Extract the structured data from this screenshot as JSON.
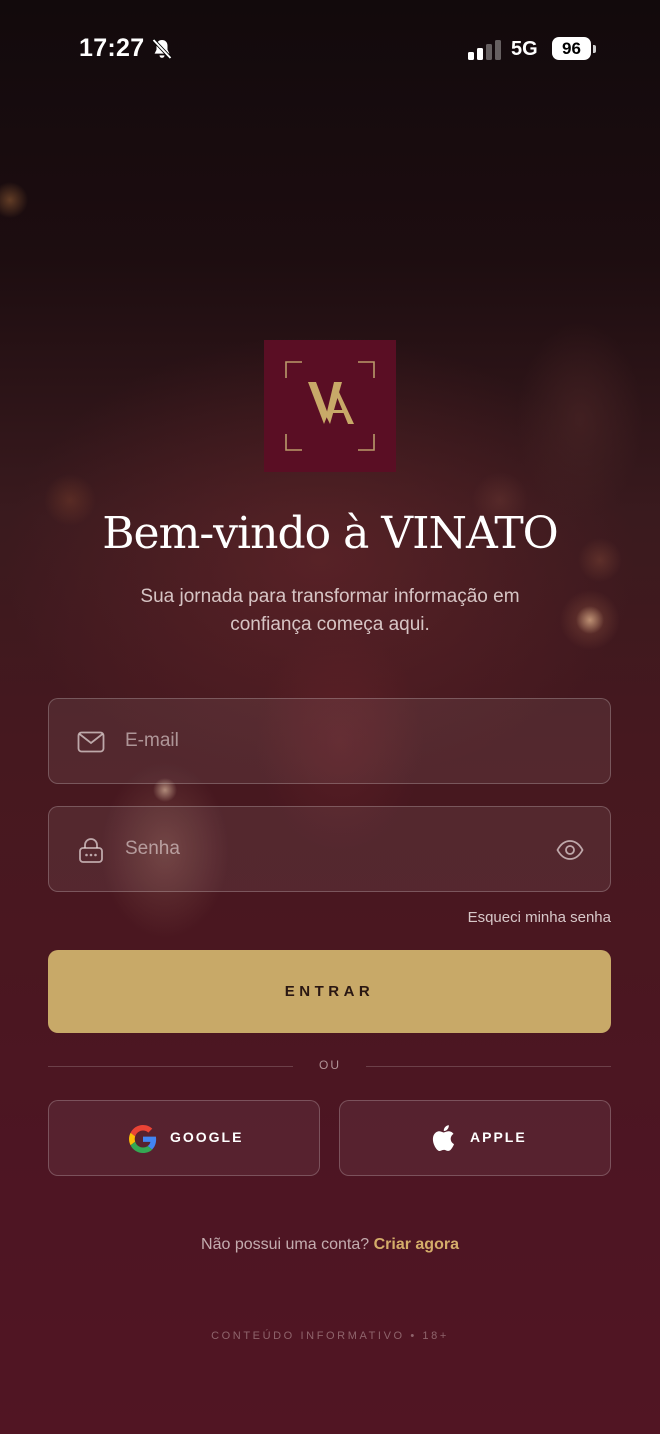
{
  "status_bar": {
    "time": "17:27",
    "network": "5G",
    "battery": "96"
  },
  "brand": {
    "logo_letters": "VA"
  },
  "header": {
    "title": "Bem-vindo à VINATO",
    "subtitle": "Sua jornada para transformar informação em confiança começa aqui."
  },
  "form": {
    "email_placeholder": "E-mail",
    "password_placeholder": "Senha",
    "forgot_password": "Esqueci minha senha",
    "submit_label": "ENTRAR"
  },
  "divider_label": "OU",
  "social": {
    "google_label": "GOOGLE",
    "apple_label": "APPLE"
  },
  "signup": {
    "prompt": "Não possui uma conta?",
    "link": "Criar agora"
  },
  "footer": {
    "text": "CONTEÚDO INFORMATIVO • 18+"
  },
  "colors": {
    "accent_gold": "#c8a968",
    "brand_burgundy": "#5a0e24"
  }
}
